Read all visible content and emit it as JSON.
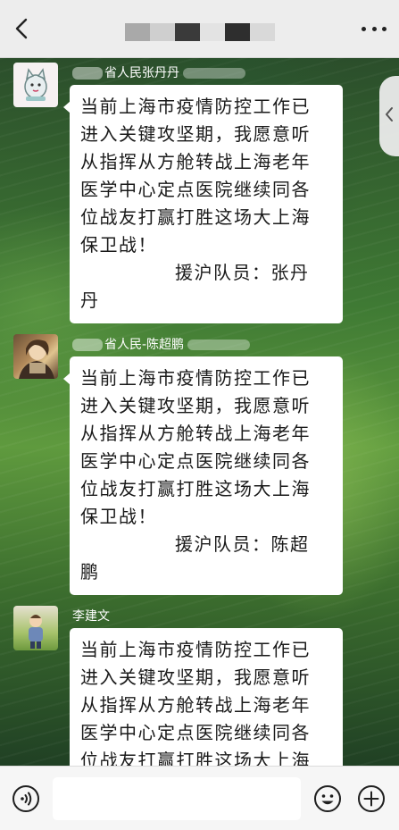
{
  "header": {
    "back_icon": "chevron-left-icon",
    "more_icon": "more-dots-icon"
  },
  "messages": [
    {
      "sender": "省人民张丹丹",
      "avatar_icon": "cartoon-cat-avatar",
      "lines": [
        "当前上海市疫情防控工作已",
        "进入关键攻坚期，我愿意听",
        "从指挥从方舱转战上海老年",
        "医学中心定点医院继续同各",
        "位战友打赢打胜这场大上海",
        "保卫战！"
      ],
      "signature_line": "援沪队员：张丹",
      "signature_wrap": "丹"
    },
    {
      "sender": "省人民-陈超鹏",
      "avatar_icon": "portrait-avatar",
      "lines": [
        "当前上海市疫情防控工作已",
        "进入关键攻坚期，我愿意听",
        "从指挥从方舱转战上海老年",
        "医学中心定点医院继续同各",
        "位战友打赢打胜这场大上海",
        "保卫战！"
      ],
      "signature_line": "援沪队员：陈超",
      "signature_wrap": "鹏"
    },
    {
      "sender": "李建文",
      "avatar_icon": "child-photo-avatar",
      "lines": [
        "当前上海市疫情防控工作已",
        "进入关键攻坚期，我愿意听",
        "从指挥从方舱转战上海老年",
        "医学中心定点医院继续同各",
        "位战友打赢打胜这场大上海"
      ]
    }
  ],
  "input_bar": {
    "voice_icon": "voice-icon",
    "emoji_icon": "emoji-icon",
    "plus_icon": "plus-circle-icon",
    "placeholder": ""
  },
  "colors": {
    "header_bg": "#ededed",
    "bubble_bg": "#ffffff",
    "input_bar_bg": "#f6f6f6"
  }
}
